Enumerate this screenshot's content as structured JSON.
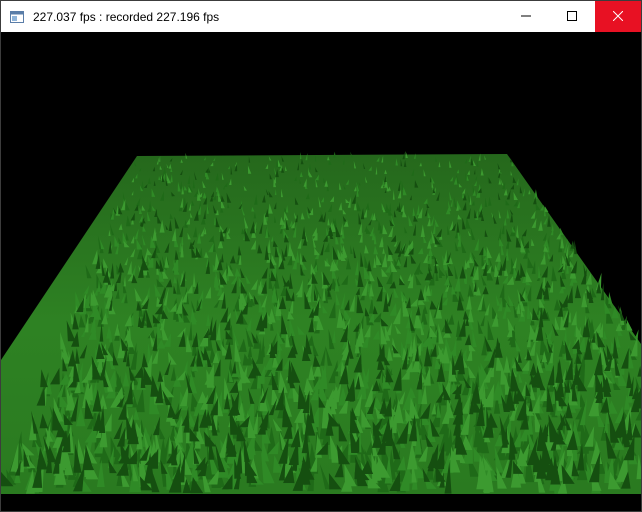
{
  "window": {
    "title": "227.037 fps : recorded 227.196 fps",
    "icons": {
      "app": "window-app-icon",
      "minimize": "minimize-icon",
      "maximize": "maximize-icon",
      "close": "close-icon"
    }
  },
  "scene": {
    "background_color": "#000000",
    "grass_colors": [
      "#1f6a18",
      "#2f8a26",
      "#3c9a30",
      "#154f10"
    ],
    "description_tag": "grass-field"
  }
}
